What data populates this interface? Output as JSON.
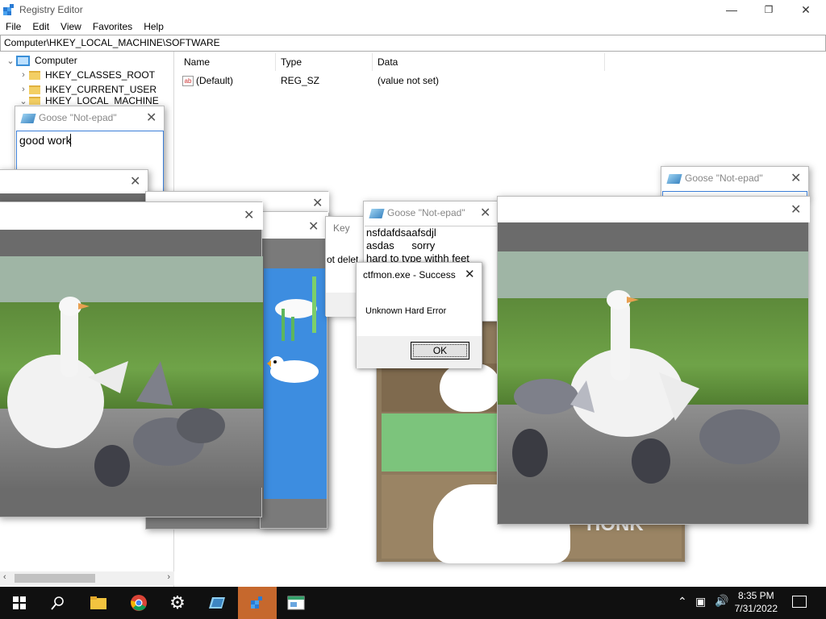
{
  "registry": {
    "title": "Registry Editor",
    "menu": [
      "File",
      "Edit",
      "View",
      "Favorites",
      "Help"
    ],
    "address": "Computer\\HKEY_LOCAL_MACHINE\\SOFTWARE",
    "tree": {
      "root": "Computer",
      "items": [
        "HKEY_CLASSES_ROOT",
        "HKEY_CURRENT_USER",
        "HKEY_LOCAL_MACHINE"
      ]
    },
    "columns": [
      "Name",
      "Type",
      "Data"
    ],
    "values": [
      {
        "name": "(Default)",
        "type": "REG_SZ",
        "data": "(value not set)"
      }
    ]
  },
  "goose_note_left": {
    "title": "Goose \"Not-epad\"",
    "text": "good work"
  },
  "goose_note_right": {
    "title": "Goose \"Not-epad\""
  },
  "goose_note_center": {
    "title": "Goose \"Not-epad\"",
    "lines": [
      "nsfdafdsaafsdjl",
      "asdas      sorry",
      "hard to type withh feet"
    ]
  },
  "partial_window": {
    "title_fragment": "Key",
    "text_fragment": "ot delet"
  },
  "error_dialog": {
    "title": "ctfmon.exe - Success",
    "message": "Unknown Hard Error",
    "ok_label": "OK"
  },
  "meme_fragment": "HONK",
  "taskbar": {
    "time": "8:35 PM",
    "date": "7/31/2022"
  }
}
